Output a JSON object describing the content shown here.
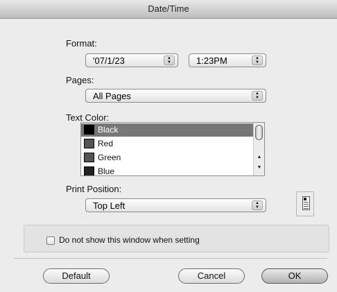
{
  "window": {
    "title": "Date/Time"
  },
  "format": {
    "label": "Format:",
    "date_value": "'07/1/23",
    "time_value": "1:23PM"
  },
  "pages": {
    "label": "Pages:",
    "value": "All Pages"
  },
  "text_color": {
    "label": "Text Color:",
    "items": [
      {
        "label": "Black",
        "swatch": "#000000",
        "selected": true
      },
      {
        "label": "Red",
        "swatch": "#555555",
        "selected": false
      },
      {
        "label": "Green",
        "swatch": "#555555",
        "selected": false
      },
      {
        "label": "Blue",
        "swatch": "#222222",
        "selected": false
      }
    ]
  },
  "print_position": {
    "label": "Print Position:",
    "value": "Top Left"
  },
  "option": {
    "checkbox_label": "Do not show this window when setting",
    "checked": false
  },
  "buttons": {
    "default_label": "Default",
    "cancel_label": "Cancel",
    "ok_label": "OK"
  },
  "icons": {
    "popup_arrows": "up-down-arrows-icon",
    "position_preview": "page-position-icon"
  }
}
